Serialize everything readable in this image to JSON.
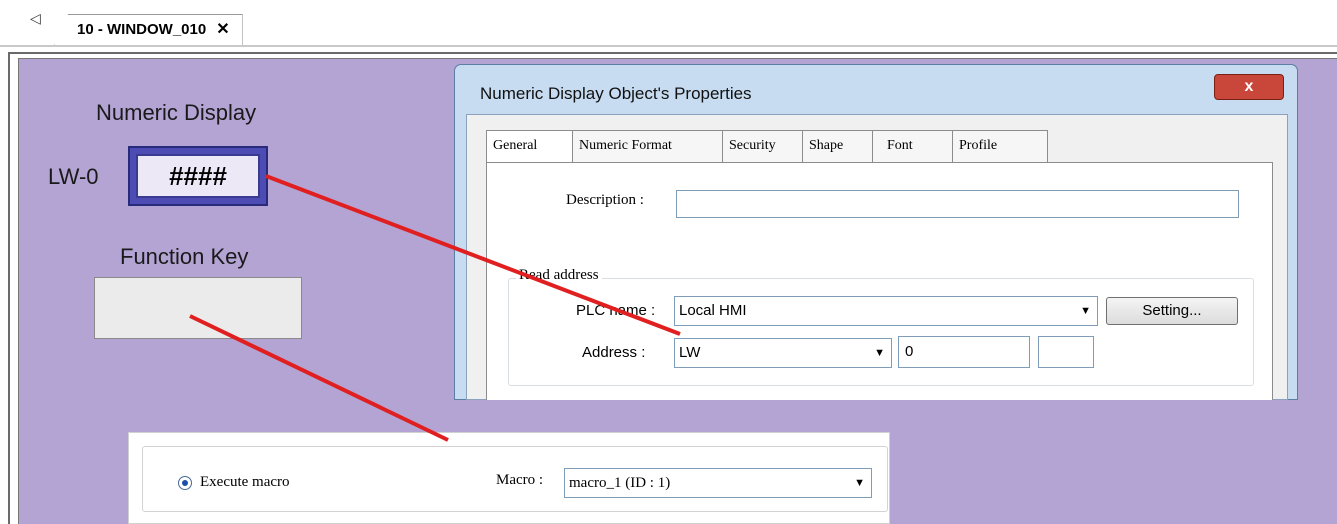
{
  "tab_bar": {
    "nav_arrow": "◁",
    "active_tab": "10 - WINDOW_010",
    "close_glyph": "✕"
  },
  "canvas": {
    "numeric_display_title": "Numeric Display",
    "numeric_display_address": "LW-0",
    "numeric_display_value": "####",
    "function_key_title": "Function Key"
  },
  "dialog": {
    "title": "Numeric Display Object's Properties",
    "close_glyph": "x",
    "tabs": [
      "General",
      "Numeric Format",
      "Security",
      "Shape",
      "Font",
      "Profile"
    ],
    "active_tab": "General",
    "description_label": "Description :",
    "description_value": "",
    "read_address_group": "Read address",
    "plc_name_label": "PLC name :",
    "plc_name_value": "Local HMI",
    "setting_button": "Setting...",
    "address_label": "Address :",
    "address_type": "LW",
    "address_value": "0",
    "address_extra": ""
  },
  "macro": {
    "radio_label": "Execute macro",
    "radio_selected": true,
    "macro_label": "Macro :",
    "macro_value": "macro_1 (ID : 1)"
  },
  "colors": {
    "canvas": "#b4a4d4",
    "pointer_line": "#e02020",
    "display_border": "#4c4cb4"
  }
}
